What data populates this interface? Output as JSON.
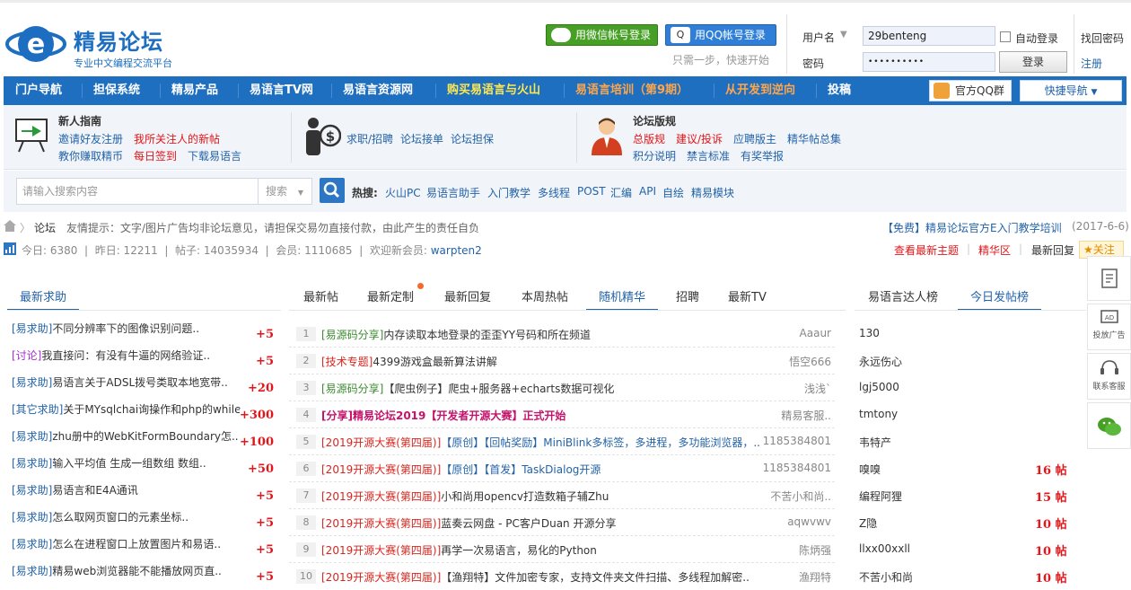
{
  "header": {
    "logo_name": "精易论坛",
    "logo_slogan": "专业中文编程交流平台",
    "wechat_login": "用微信帐号登录",
    "qq_login": "用QQ帐号登录",
    "login_tip": "只需一步，快速开始",
    "username_label": "用户名",
    "username_value": "29benteng",
    "password_label": "密码",
    "password_value": "••••••••••",
    "auto_login": "自动登录",
    "login_btn": "登录",
    "find_pwd": "找回密码",
    "register": "注册"
  },
  "nav": {
    "items": [
      "门户导航",
      "担保系统",
      "精易产品",
      "易语言TV网",
      "易语言资源网",
      "购买易语言与火山",
      "易语言培训（第9期）",
      "从开发到逆向",
      "投稿"
    ],
    "qq_group": "官方QQ群",
    "quick_nav": "快捷导航"
  },
  "guide": {
    "newbie_title": "新人指南",
    "invite": "邀请好友注册",
    "my_follows": "我所关注人的新帖",
    "earn": "教你赚取精币",
    "daily": "每日签到",
    "download": "下载易语言",
    "jobs": "求职/招聘",
    "orders": "论坛接单",
    "guarantee": "论坛担保",
    "rules_title": "论坛版规",
    "rules": "总版规",
    "suggest": "建议/投诉",
    "apply_mod": "应聘版主",
    "essence": "精华帖总集",
    "points": "积分说明",
    "banned": "禁言标准",
    "report": "有奖举报"
  },
  "search": {
    "placeholder": "请输入搜索内容",
    "select": "搜索",
    "hot_label": "热搜:",
    "hot": [
      "火山PC",
      "易语言助手",
      "入门教学",
      "多线程",
      "POST",
      "汇编",
      "API",
      "自绘",
      "精易模块"
    ]
  },
  "notice": {
    "forum": "论坛",
    "tip": "友情提示：文字/图片广告均非论坛意见，请担保交易勿直接付款，由此产生的责任自负",
    "promo": "【免费】精易论坛官方E入门教学培训",
    "promo_date": "(2017-6-6)"
  },
  "stats": {
    "text": "今日: 6380  |  昨日: 12211  |  帖子: 14035934  |  会员: 1110685  |  欢迎新会员: ",
    "new_member": "warpten2",
    "links": [
      "查看最新主题",
      "精华区",
      "最新回复"
    ],
    "follow": "关注"
  },
  "left": {
    "tab": "最新求助",
    "rows": [
      {
        "tag": "[易求助]",
        "title": "不同分辨率下的图像识别问题..",
        "pts": "+5",
        "c": "blue"
      },
      {
        "tag": "[讨论]",
        "title": "我直接问：有没有牛逼的网络验证..",
        "pts": "+5",
        "c": "purple"
      },
      {
        "tag": "[易求助]",
        "title": "易语言关于ADSL拨号类取本地宽带..",
        "pts": "+20",
        "c": "blue"
      },
      {
        "tag": "[其它求助]",
        "title": "关于MYsqlchai询操作和php的while..",
        "pts": "+300",
        "c": "blue"
      },
      {
        "tag": "[易求助]",
        "title": "zhu册中的WebKitFormBoundary怎..",
        "pts": "+100",
        "c": "blue"
      },
      {
        "tag": "[易求助]",
        "title": "输入平均值 生成一组数组 数组..",
        "pts": "+50",
        "c": "blue"
      },
      {
        "tag": "[易求助]",
        "title": "易语言和E4A通讯",
        "pts": "+5",
        "c": "blue"
      },
      {
        "tag": "[易求助]",
        "title": "怎么取网页窗口的元素坐标..",
        "pts": "+5",
        "c": "blue"
      },
      {
        "tag": "[易求助]",
        "title": "怎么在进程窗口上放置图片和易语..",
        "pts": "+5",
        "c": "blue"
      },
      {
        "tag": "[易求助]",
        "title": "精易web浏览器能不能播放网页直..",
        "pts": "+5",
        "c": "blue"
      }
    ]
  },
  "center": {
    "tabs": [
      "最新帖",
      "最新定制",
      "最新回复",
      "本周热帖",
      "随机精华",
      "招聘",
      "最新TV"
    ],
    "rows": [
      {
        "n": "1",
        "tag": "[易源码分享]",
        "title": "内存读取本地登录的歪歪YY号码和所在频道",
        "author": "Aaaur",
        "c": "green"
      },
      {
        "n": "2",
        "tag": "[技术专题]",
        "title": "4399游戏盒最新算法讲解",
        "author": "悟空666",
        "c": "red"
      },
      {
        "n": "3",
        "tag": "[易源码分享]",
        "title": "【爬虫例子】爬虫+服务器+echarts数据可视化",
        "author": "浅浅`",
        "c": "green"
      },
      {
        "n": "4",
        "tag": "[分享]",
        "title": "精易论坛2019【开发者开源大赛】正式开始",
        "author": "精易客服..",
        "c": "bold"
      },
      {
        "n": "5",
        "tag": "[2019开源大赛(第四届)]",
        "title": "【原创】【回帖奖励】MiniBlink多标签，多进程，多功能浏览器，..",
        "author": "1185384801",
        "c": "red"
      },
      {
        "n": "6",
        "tag": "[2019开源大赛(第四届)]",
        "title": "【原创】【首发】TaskDialog开源",
        "author": "1185384801",
        "c": "red"
      },
      {
        "n": "7",
        "tag": "[2019开源大赛(第四届)]",
        "title": "小和尚用opencv打造数箱子辅Zhu",
        "author": "不苦小和尚..",
        "c": "red"
      },
      {
        "n": "8",
        "tag": "[2019开源大赛(第四届)]",
        "title": "蓝奏云网盘 - PC客户Duan 开源分享",
        "author": "aqwvwv",
        "c": "red"
      },
      {
        "n": "9",
        "tag": "[2019开源大赛(第四届)]",
        "title": "再学一次易语言，易化的Python",
        "author": "陈炳强",
        "c": "red"
      },
      {
        "n": "10",
        "tag": "[2019开源大赛(第四届)]",
        "title": "【渔翔特】文件加密专家，支持文件夹文件扫描、多线程加解密..",
        "author": "渔翔特",
        "c": "red"
      }
    ]
  },
  "right": {
    "tabs": [
      "易语言达人榜",
      "今日发帖榜"
    ],
    "rows": [
      {
        "name": "130",
        "count": ""
      },
      {
        "name": "永远伤心",
        "count": ""
      },
      {
        "name": "lgj5000",
        "count": ""
      },
      {
        "name": "tmtony",
        "count": ""
      },
      {
        "name": "韦特产",
        "count": ""
      },
      {
        "name": "嗅嗅",
        "count": "16 帖"
      },
      {
        "name": "编程阿狸",
        "count": "15 帖"
      },
      {
        "name": "Z隐",
        "count": "10 帖"
      },
      {
        "name": "llxx00xxll",
        "count": "10 帖"
      },
      {
        "name": "不苦小和尚",
        "count": "10 帖"
      }
    ]
  },
  "sidebar": {
    "ad": "投放广告",
    "service": "联系客服"
  }
}
